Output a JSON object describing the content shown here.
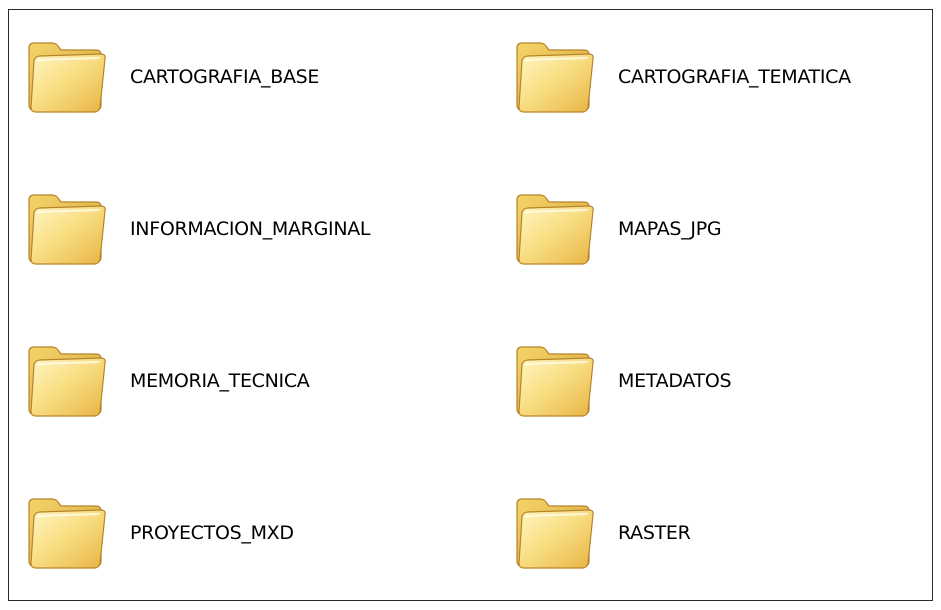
{
  "folders": [
    {
      "name": "CARTOGRAFIA_BASE",
      "icon": "folder-icon"
    },
    {
      "name": "CARTOGRAFIA_TEMATICA",
      "icon": "folder-icon"
    },
    {
      "name": "INFORMACION_MARGINAL",
      "icon": "folder-icon"
    },
    {
      "name": "MAPAS_JPG",
      "icon": "folder-icon"
    },
    {
      "name": "MEMORIA_TECNICA",
      "icon": "folder-icon"
    },
    {
      "name": "METADATOS",
      "icon": "folder-icon"
    },
    {
      "name": "PROYECTOS_MXD",
      "icon": "folder-icon"
    },
    {
      "name": "RASTER",
      "icon": "folder-icon"
    }
  ],
  "colors": {
    "folder_body": "#f5d35c",
    "folder_light": "#fff3b0",
    "folder_dark": "#c8932a",
    "border": "#2a2a2a"
  }
}
